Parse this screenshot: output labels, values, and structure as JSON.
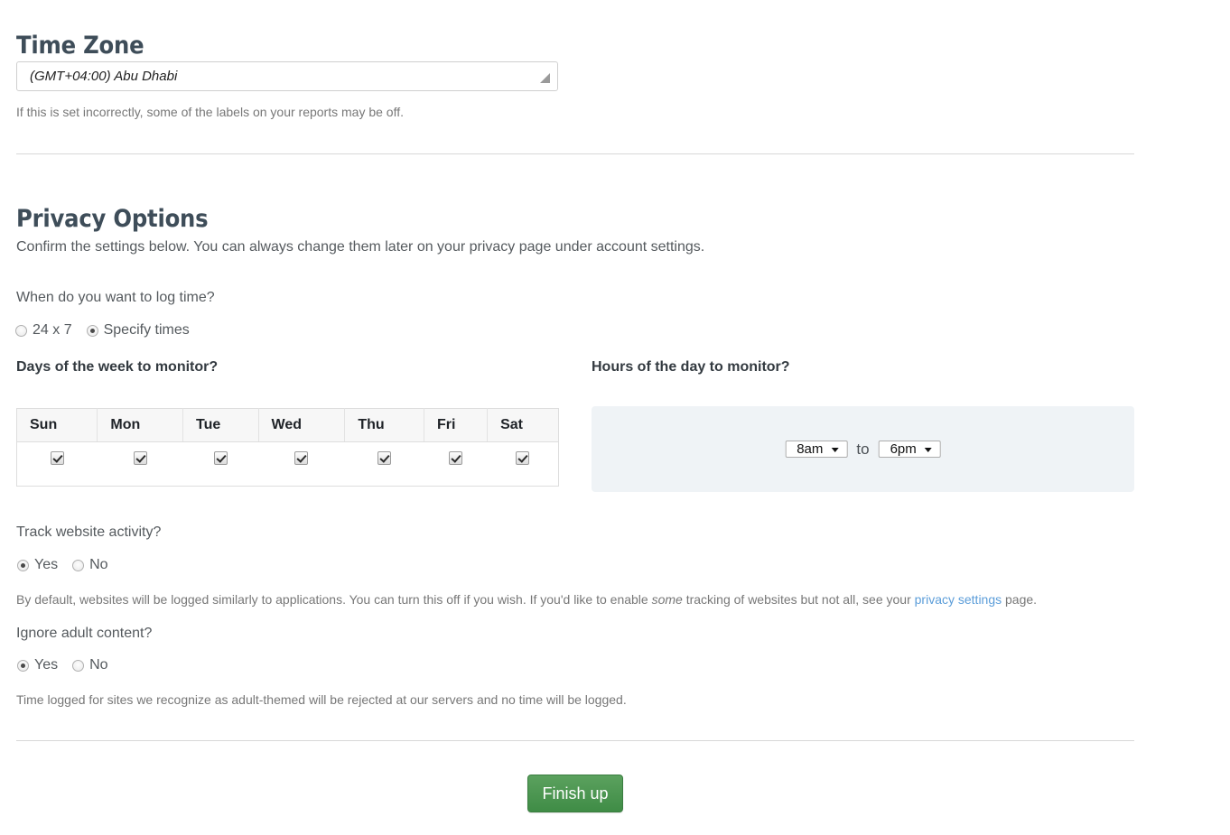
{
  "timezone": {
    "heading": "Time Zone",
    "selected": "(GMT+04:00) Abu Dhabi",
    "helper": "If this is set incorrectly, some of the labels on your reports may be off."
  },
  "privacy": {
    "heading": "Privacy Options",
    "intro": "Confirm the settings below. You can always change them later on your privacy page under account settings.",
    "log_time": {
      "question": "When do you want to log time?",
      "options": [
        {
          "label": "24 x 7",
          "checked": false
        },
        {
          "label": "Specify times",
          "checked": true
        }
      ]
    },
    "days": {
      "label": "Days of the week to monitor?",
      "columns": [
        "Sun",
        "Mon",
        "Tue",
        "Wed",
        "Thu",
        "Fri",
        "Sat"
      ],
      "checked": [
        true,
        true,
        true,
        true,
        true,
        true,
        true
      ]
    },
    "hours": {
      "label": "Hours of the day to monitor?",
      "from_value": "8am",
      "separator": "to",
      "to_value": "6pm"
    },
    "track_website": {
      "question": "Track website activity?",
      "options": [
        {
          "label": "Yes",
          "checked": true
        },
        {
          "label": "No",
          "checked": false
        }
      ],
      "helper_part1": "By default, websites will be logged similarly to applications. You can turn this off if you wish. If you'd like to enable ",
      "helper_em": "some",
      "helper_part2": " tracking of websites but not all, see your ",
      "helper_link": "privacy settings",
      "helper_part3": " page."
    },
    "adult_content": {
      "question": "Ignore adult content?",
      "options": [
        {
          "label": "Yes",
          "checked": true
        },
        {
          "label": "No",
          "checked": false
        }
      ],
      "helper": "Time logged for sites we recognize as adult-themed will be rejected at our servers and no time will be logged."
    }
  },
  "footer": {
    "finish_label": "Finish up"
  },
  "colors": {
    "heading": "#3e4d59",
    "link": "#5b9dd9",
    "button_green": "#4a9350",
    "panel_bg": "#eff3f6"
  }
}
